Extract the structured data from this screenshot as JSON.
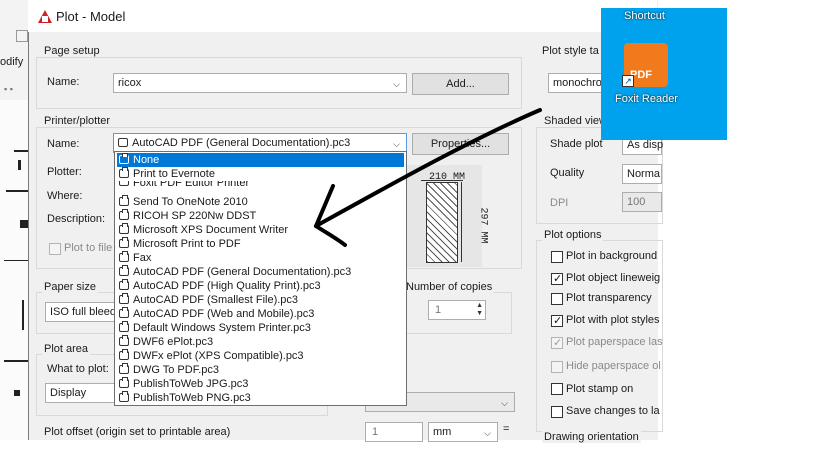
{
  "background_app": {
    "toolbar_fragment": "odify"
  },
  "dialog": {
    "title": "Plot - Model",
    "page_setup": {
      "group_label": "Page setup",
      "name_label": "Name:",
      "name_value": "ricox",
      "add_button": "Add..."
    },
    "printer_plotter": {
      "group_label": "Printer/plotter",
      "name_label": "Name:",
      "name_value": "AutoCAD PDF (General Documentation).pc3",
      "properties_button": "Properties...",
      "plotter_label": "Plotter:",
      "where_label": "Where:",
      "description_label": "Description:",
      "plot_to_file_label": "Plot to file",
      "preview_width_label": "210 MM",
      "preview_height_label": "297 MM"
    },
    "printer_dropdown": {
      "items": [
        {
          "label": "None",
          "highlighted": true
        },
        {
          "label": "Print to Evernote"
        },
        {
          "label": "Foxit PDF Editor Printer"
        },
        {
          "label": "Send To OneNote 2010"
        },
        {
          "label": "RICOH SP 220Nw DDST"
        },
        {
          "label": "Microsoft XPS Document Writer"
        },
        {
          "label": "Microsoft Print to PDF"
        },
        {
          "label": "Fax"
        },
        {
          "label": "AutoCAD PDF (General Documentation).pc3"
        },
        {
          "label": "AutoCAD PDF (High Quality Print).pc3"
        },
        {
          "label": "AutoCAD PDF (Smallest File).pc3"
        },
        {
          "label": "AutoCAD PDF (Web and Mobile).pc3"
        },
        {
          "label": "Default Windows System Printer.pc3"
        },
        {
          "label": "DWF6 ePlot.pc3"
        },
        {
          "label": "DWFx ePlot (XPS Compatible).pc3"
        },
        {
          "label": "DWG To PDF.pc3"
        },
        {
          "label": "PublishToWeb JPG.pc3"
        },
        {
          "label": "PublishToWeb PNG.pc3"
        }
      ]
    },
    "paper_size": {
      "group_label": "Paper size",
      "value": "ISO full bleed"
    },
    "copies": {
      "label": "Number of copies",
      "value": "1"
    },
    "plot_area": {
      "group_label": "Plot area",
      "what_label": "What to plot:",
      "what_value": "Display"
    },
    "plot_scale": {
      "scale_value": "1",
      "unit_value": "mm",
      "equals": "="
    },
    "plot_offset": {
      "label": "Plot offset (origin set to printable area)"
    },
    "plot_style_table": {
      "group_label": "Plot style ta",
      "value": "monochro"
    },
    "shaded_viewport": {
      "group_label": "Shaded view",
      "shade_plot_label": "Shade plot",
      "shade_plot_value": "As disp",
      "quality_label": "Quality",
      "quality_value": "Norma",
      "dpi_label": "DPI",
      "dpi_value": "100"
    },
    "plot_options": {
      "group_label": "Plot options",
      "options": [
        {
          "label": "Plot in background",
          "checked": false,
          "disabled": false
        },
        {
          "label": "Plot object lineweig",
          "checked": true,
          "disabled": false
        },
        {
          "label": "Plot transparency",
          "checked": false,
          "disabled": false
        },
        {
          "label": "Plot with plot styles",
          "checked": true,
          "disabled": false
        },
        {
          "label": "Plot paperspace las",
          "checked": true,
          "disabled": true
        },
        {
          "label": "Hide paperspace ol",
          "checked": false,
          "disabled": true
        },
        {
          "label": "Plot stamp on",
          "checked": false,
          "disabled": false
        },
        {
          "label": "Save changes to la",
          "checked": false,
          "disabled": false
        }
      ]
    },
    "drawing_orientation": {
      "label": "Drawing orientation"
    }
  },
  "desktop_shortcut": {
    "top_label": "Shortcut",
    "app_name": "Foxit Reader",
    "logo_text": "PDF",
    "tile_color": "#00a2ed",
    "logo_color": "#f07a1c",
    "shortcut_arrow_icon": "↗"
  },
  "annotation": {
    "arrow_color": "#000000",
    "icon": "hand-drawn-arrow-icon"
  }
}
